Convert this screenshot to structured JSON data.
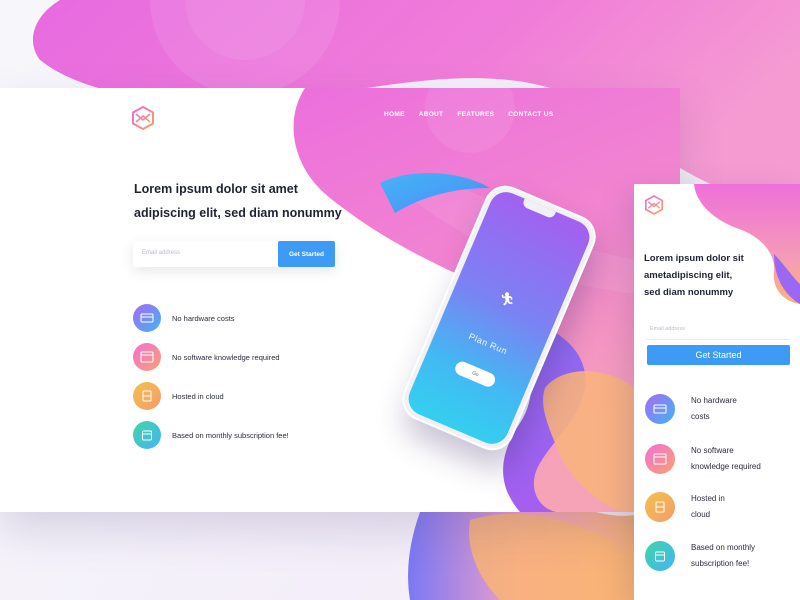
{
  "nav": {
    "items": [
      "HOME",
      "ABOUT",
      "FEATURES",
      "CONTACT US"
    ]
  },
  "hero": {
    "title_line1": "Lorem ipsum dolor sit amet",
    "title_line2": "adipiscing elit, sed diam nonummy",
    "email_placeholder": "Email address",
    "cta_label": "Get Started"
  },
  "features": [
    {
      "label": "No hardware costs",
      "icon": "card-icon"
    },
    {
      "label": "No software knowledge required",
      "icon": "browser-icon"
    },
    {
      "label": "Hosted in cloud",
      "icon": "cloud-server-icon"
    },
    {
      "label": "Based on monthly subscription fee!",
      "icon": "calendar-icon"
    }
  ],
  "phone": {
    "screen_title": "Plan Run",
    "button_label": "Go"
  },
  "mobile": {
    "title_line1": "Lorem ipsum dolor sit",
    "title_line2": "ametadipiscing elit,",
    "title_line3": "sed diam nonummy",
    "email_placeholder": "Email address",
    "cta_label": "Get Started",
    "features": [
      {
        "line1": "No hardware",
        "line2": "costs"
      },
      {
        "line1": "No software",
        "line2": "knowledge required"
      },
      {
        "line1": "Hosted in",
        "line2": "cloud"
      },
      {
        "line1": "Based on monthly",
        "line2": "subscription fee!"
      }
    ]
  },
  "colors": {
    "accent_blue": "#3d9bf5",
    "pink": "#f070d8",
    "purple": "#a45ff0",
    "orange": "#f9b474",
    "heading_text": "#1f2233"
  }
}
